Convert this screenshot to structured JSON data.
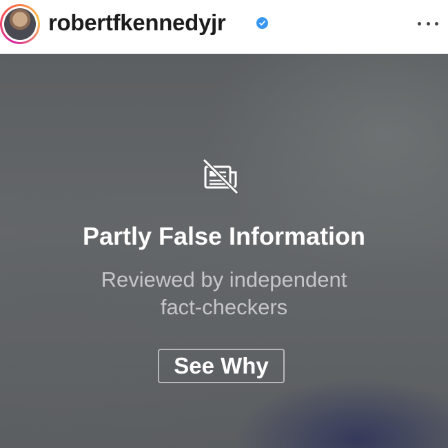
{
  "post": {
    "username": "robertfkennedyjr",
    "verified": true,
    "icons": {
      "verified": "verified-badge-icon",
      "more": "more-options-icon",
      "warning": "news-off-icon"
    },
    "colors": {
      "verified": "#3897f0",
      "overlay": "#616466"
    }
  },
  "warning": {
    "title": "Partly False Information",
    "subtitle_line1": "Reviewed by independent",
    "subtitle_line2": "fact-checkers",
    "button_label": "See Why"
  }
}
